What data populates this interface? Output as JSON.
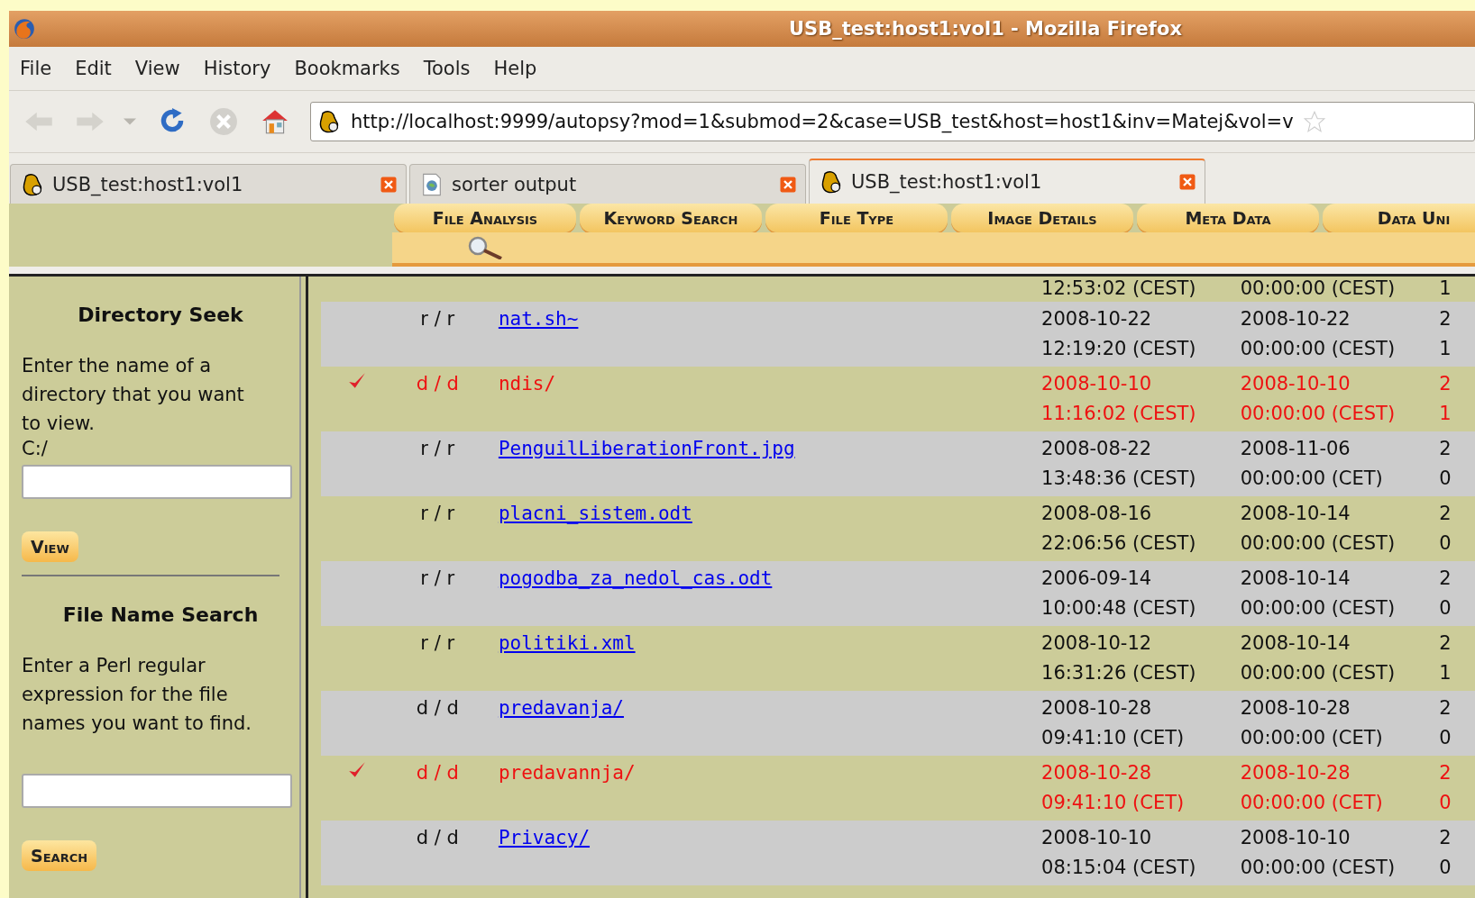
{
  "window": {
    "title": "USB_test:host1:vol1 - Mozilla Firefox"
  },
  "menu": [
    "File",
    "Edit",
    "View",
    "History",
    "Bookmarks",
    "Tools",
    "Help"
  ],
  "address": {
    "value": "http://localhost:9999/autopsy?mod=1&submod=2&case=USB_test&host=host1&inv=Matej&vol=v"
  },
  "tabs": [
    {
      "label": "USB_test:host1:vol1",
      "kind": "autopsy",
      "selected": false
    },
    {
      "label": "sorter output",
      "kind": "page",
      "selected": false
    },
    {
      "label": "USB_test:host1:vol1",
      "kind": "autopsy",
      "selected": true
    }
  ],
  "modules": [
    {
      "label": "File Analysis",
      "selected": true
    },
    {
      "label": "Keyword Search",
      "selected": false
    },
    {
      "label": "File Type",
      "selected": false
    },
    {
      "label": "Image Details",
      "selected": false
    },
    {
      "label": "Meta Data",
      "selected": false
    },
    {
      "label": "Data Uni",
      "selected": false
    }
  ],
  "sidebar": {
    "directory_seek": {
      "title": "Directory Seek",
      "text": "Enter the name of a directory that you want to view.",
      "path": "C:/",
      "button": "View"
    },
    "file_name_search": {
      "title": "File Name Search",
      "text": "Enter a Perl regular expression for the file names you want to find.",
      "button": "Search"
    }
  },
  "partial_row": {
    "written": "12:53:02 (CEST)",
    "accessed": "00:00:00 (CEST)",
    "column_3": "1"
  },
  "rows": [
    {
      "deleted": false,
      "type": "r / r",
      "name": "nat.sh~",
      "written": [
        "2008-10-22",
        "12:19:20 (CEST)"
      ],
      "accessed": [
        "2008-10-22",
        "00:00:00 (CEST)"
      ],
      "column_3": [
        "2",
        "1"
      ]
    },
    {
      "deleted": true,
      "type": "d / d",
      "name": "ndis/",
      "written": [
        "2008-10-10",
        "11:16:02 (CEST)"
      ],
      "accessed": [
        "2008-10-10",
        "00:00:00 (CEST)"
      ],
      "column_3": [
        "2",
        "1"
      ]
    },
    {
      "deleted": false,
      "type": "r / r",
      "name": "PenguilLiberationFront.jpg",
      "written": [
        "2008-08-22",
        "13:48:36 (CEST)"
      ],
      "accessed": [
        "2008-11-06",
        "00:00:00 (CET)"
      ],
      "column_3": [
        "2",
        "0"
      ]
    },
    {
      "deleted": false,
      "type": "r / r",
      "name": "placni_sistem.odt",
      "written": [
        "2008-08-16",
        "22:06:56 (CEST)"
      ],
      "accessed": [
        "2008-10-14",
        "00:00:00 (CEST)"
      ],
      "column_3": [
        "2",
        "0"
      ]
    },
    {
      "deleted": false,
      "type": "r / r",
      "name": "pogodba_za_nedol_cas.odt",
      "written": [
        "2006-09-14",
        "10:00:48 (CEST)"
      ],
      "accessed": [
        "2008-10-14",
        "00:00:00 (CEST)"
      ],
      "column_3": [
        "2",
        "0"
      ]
    },
    {
      "deleted": false,
      "type": "r / r",
      "name": "politiki.xml",
      "written": [
        "2008-10-12",
        "16:31:26 (CEST)"
      ],
      "accessed": [
        "2008-10-14",
        "00:00:00 (CEST)"
      ],
      "column_3": [
        "2",
        "1"
      ]
    },
    {
      "deleted": false,
      "type": "d / d",
      "name": "predavanja/",
      "written": [
        "2008-10-28",
        "09:41:10 (CET)"
      ],
      "accessed": [
        "2008-10-28",
        "00:00:00 (CET)"
      ],
      "column_3": [
        "2",
        "0"
      ]
    },
    {
      "deleted": true,
      "type": "d / d",
      "name": "predavannja/",
      "written": [
        "2008-10-28",
        "09:41:10 (CET)"
      ],
      "accessed": [
        "2008-10-28",
        "00:00:00 (CET)"
      ],
      "column_3": [
        "2",
        "0"
      ]
    },
    {
      "deleted": false,
      "type": "d / d",
      "name": "Privacy/",
      "written": [
        "2008-10-10",
        "08:15:04 (CEST)"
      ],
      "accessed": [
        "2008-10-10",
        "00:00:00 (CEST)"
      ],
      "column_3": [
        "2",
        "0"
      ]
    }
  ]
}
